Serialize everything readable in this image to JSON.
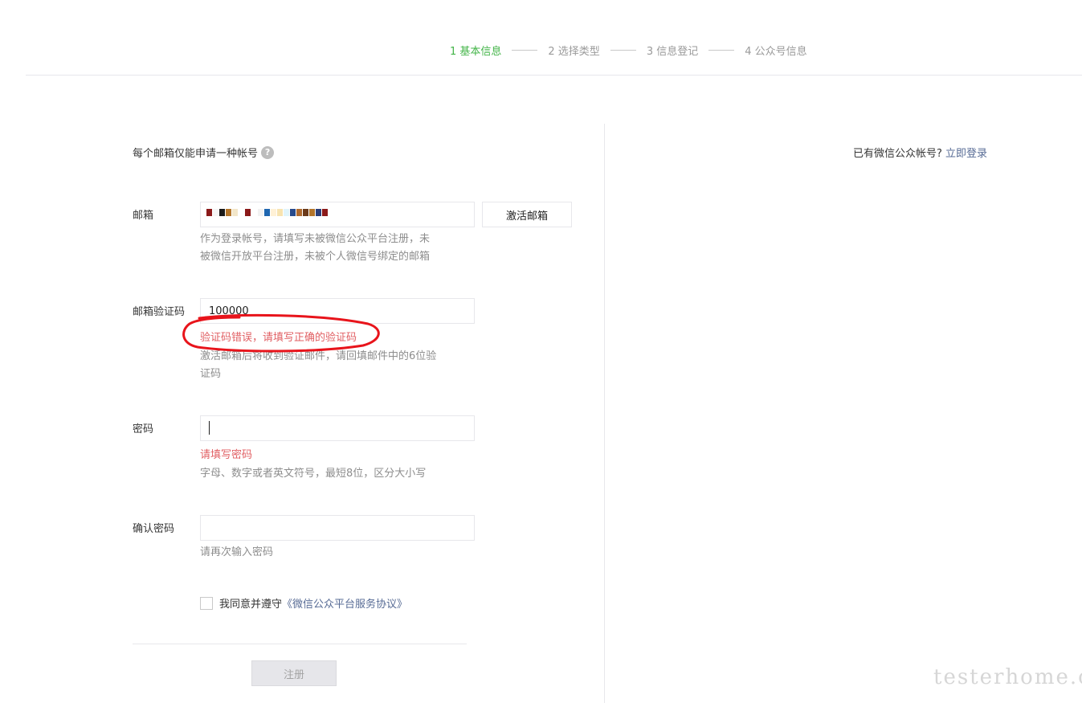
{
  "steps": [
    {
      "label": "1 基本信息"
    },
    {
      "label": "2 选择类型"
    },
    {
      "label": "3 信息登记"
    },
    {
      "label": "4 公众号信息"
    }
  ],
  "note": {
    "text": "每个邮箱仅能申请一种帐号",
    "help_icon": "?"
  },
  "login": {
    "prompt": "已有微信公众帐号?",
    "link": "立即登录"
  },
  "email": {
    "label": "邮箱",
    "activate_button": "激活邮箱",
    "tips_line1": "作为登录帐号，请填写未被微信公众平台注册，未",
    "tips_line2": "被微信开放平台注册，未被个人微信号绑定的邮箱"
  },
  "code": {
    "label": "邮箱验证码",
    "value": "100000",
    "error": "验证码错误，请填写正确的验证码",
    "tips_line1": "激活邮箱后将收到验证邮件，请回填邮件中的6位验",
    "tips_line2": "证码"
  },
  "password": {
    "label": "密码",
    "value": "",
    "error": "请填写密码",
    "tips": "字母、数字或者英文符号，最短8位，区分大小写"
  },
  "confirm": {
    "label": "确认密码",
    "value": "",
    "tips": "请再次输入密码"
  },
  "agreement": {
    "prefix": "我同意并遵守",
    "link": "《微信公众平台服务协议》"
  },
  "register_button": "注册",
  "watermark": "testerhome.com",
  "colors": {
    "accent": "#44b549",
    "error": "#e15f63",
    "link": "#576b95",
    "annotation": "#e8141b"
  },
  "email_mask_colors": [
    "#8b1a1a",
    "#f5f5f5",
    "#1a1a1a",
    "#b3752a",
    "#f2e6c9",
    "#ffffff",
    "#8b1a1a",
    "#ffffff",
    "#f2f2f2",
    "#1f66b0",
    "#fff1d6",
    "#f7e3b0",
    "#e0f4fb",
    "#274a8c",
    "#b06a2d",
    "#6b3a1a",
    "#b3752a",
    "#2a3f7a",
    "#8b1a1a"
  ]
}
